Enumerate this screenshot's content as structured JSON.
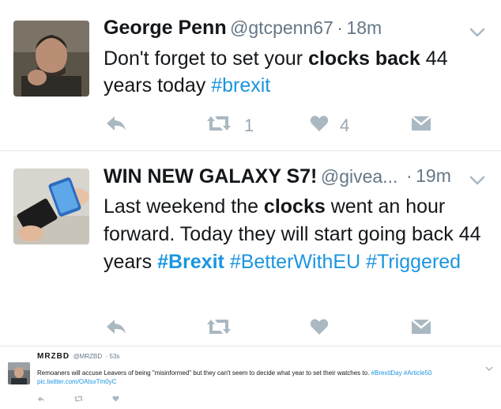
{
  "tweets": [
    {
      "name": "George Penn",
      "handle": "@gtcpenn67",
      "separator": "·",
      "time": "18m",
      "text_parts": [
        "Don't forget to set your ",
        "clocks back",
        " 44 years today ",
        "#brexit"
      ],
      "retweets": "1",
      "likes": "4"
    },
    {
      "name": "WIN NEW GALAXY S7!",
      "handle": "@givea...",
      "separator": "·",
      "time": "19m",
      "text_parts": [
        "Last weekend the ",
        "clocks",
        " went an hour forward. Today they will start going back 44 years ",
        "#Brexit",
        " ",
        "#BetterWithEU",
        " ",
        "#Triggered"
      ]
    },
    {
      "name": "MRZBD",
      "handle": "@MRZBD",
      "time": "· 53s",
      "text_parts": [
        "Remoaners will accuse Leavers of being \"misinformed\" but they can't seem to decide what year to set their watches to. ",
        "#BrexitDay",
        " ",
        "#Article50",
        "pic.twitter.com/OAIsxTm0yC"
      ]
    }
  ],
  "icons": {
    "reply": "reply-arrow-icon",
    "retweet": "retweet-icon",
    "like": "heart-icon",
    "message": "envelope-icon",
    "more": "chevron-down-icon"
  },
  "colors": {
    "hashtag": "#1b95e0",
    "secondary_text": "#657786",
    "icon": "#aab8c2",
    "divider": "#e1e8ed"
  }
}
